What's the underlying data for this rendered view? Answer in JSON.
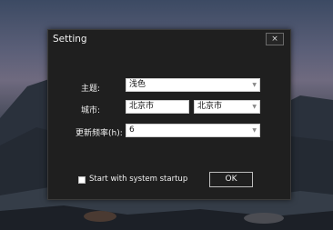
{
  "window": {
    "title": "Setting",
    "close_glyph": "×"
  },
  "form": {
    "theme": {
      "label": "主题:",
      "value": "浅色"
    },
    "city": {
      "label": "城市:",
      "text_value": "北京市",
      "select_value": "北京市"
    },
    "refresh": {
      "label": "更新频率(h):",
      "value": "6"
    }
  },
  "startup": {
    "label": "Start with system startup",
    "checked": false
  },
  "ok_button": {
    "label": "OK"
  },
  "icons": {
    "dropdown": "chevron-down-icon",
    "close": "close-icon"
  }
}
